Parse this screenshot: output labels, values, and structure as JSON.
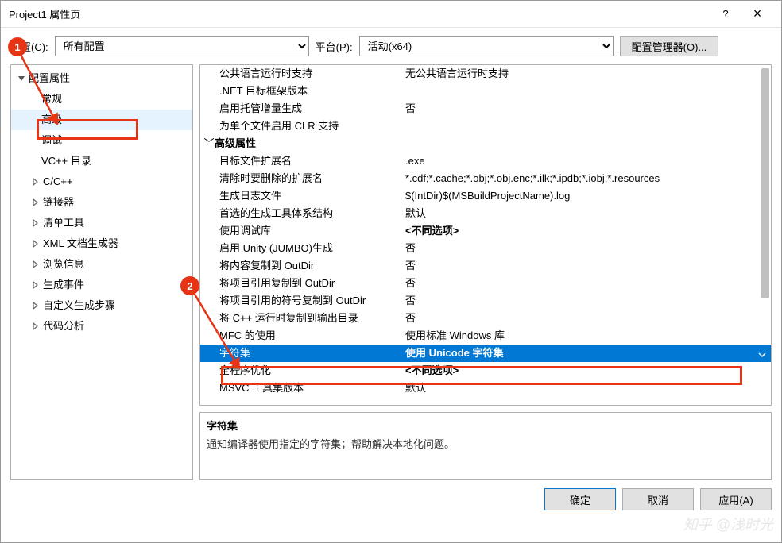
{
  "title": "Project1 属性页",
  "help_symbol": "?",
  "close_symbol": "×",
  "top": {
    "config_label": "配置(C):",
    "config_value": "所有配置",
    "platform_label": "平台(P):",
    "platform_value": "活动(x64)",
    "manager_button": "配置管理器(O)..."
  },
  "tree": [
    {
      "label": "配置属性",
      "depth": 1,
      "expanded": true,
      "expander": true
    },
    {
      "label": "常规",
      "depth": 2
    },
    {
      "label": "高级",
      "depth": 2,
      "selected": true
    },
    {
      "label": "调试",
      "depth": 2
    },
    {
      "label": "VC++ 目录",
      "depth": 2
    },
    {
      "label": "C/C++",
      "depth": 2,
      "expander": true
    },
    {
      "label": "链接器",
      "depth": 2,
      "expander": true
    },
    {
      "label": "清单工具",
      "depth": 2,
      "expander": true
    },
    {
      "label": "XML 文档生成器",
      "depth": 2,
      "expander": true
    },
    {
      "label": "浏览信息",
      "depth": 2,
      "expander": true
    },
    {
      "label": "生成事件",
      "depth": 2,
      "expander": true
    },
    {
      "label": "自定义生成步骤",
      "depth": 2,
      "expander": true
    },
    {
      "label": "代码分析",
      "depth": 2,
      "expander": true
    }
  ],
  "props": [
    {
      "k": "公共语言运行时支持",
      "v": "无公共语言运行时支持"
    },
    {
      "k": ".NET 目标框架版本",
      "v": ""
    },
    {
      "k": "启用托管增量生成",
      "v": "否"
    },
    {
      "k": "为单个文件启用 CLR 支持",
      "v": ""
    },
    {
      "group": "高级属性"
    },
    {
      "k": "目标文件扩展名",
      "v": ".exe"
    },
    {
      "k": "清除时要删除的扩展名",
      "v": "*.cdf;*.cache;*.obj;*.obj.enc;*.ilk;*.ipdb;*.iobj;*.resources"
    },
    {
      "k": "生成日志文件",
      "v": "$(IntDir)$(MSBuildProjectName).log"
    },
    {
      "k": "首选的生成工具体系结构",
      "v": "默认"
    },
    {
      "k": "使用调试库",
      "v": "<不同选项>",
      "bold": true
    },
    {
      "k": "启用 Unity (JUMBO)生成",
      "v": "否"
    },
    {
      "k": "将内容复制到 OutDir",
      "v": "否"
    },
    {
      "k": "将项目引用复制到 OutDir",
      "v": "否"
    },
    {
      "k": "将项目引用的符号复制到 OutDir",
      "v": "否"
    },
    {
      "k": "将 C++ 运行时复制到输出目录",
      "v": "否"
    },
    {
      "k": "MFC 的使用",
      "v": "使用标准 Windows 库"
    },
    {
      "k": "字符集",
      "v": "使用 Unicode 字符集",
      "selected": true,
      "dropdown": true
    },
    {
      "k": "全程序优化",
      "v": "<不同选项>",
      "bold": true
    },
    {
      "k": "MSVC 工具集版本",
      "v": "默认"
    }
  ],
  "description": {
    "title": "字符集",
    "text": "通知编译器使用指定的字符集；帮助解决本地化问题。"
  },
  "buttons": {
    "ok": "确定",
    "cancel": "取消",
    "apply": "应用(A)"
  },
  "annotations": {
    "badge1": "1",
    "badge2": "2"
  },
  "watermark": "知乎 @浅时光"
}
